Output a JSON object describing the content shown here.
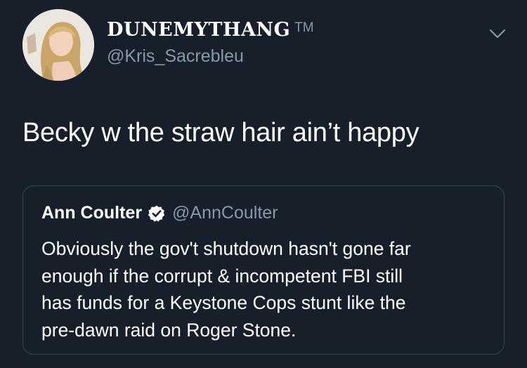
{
  "author": {
    "display_name": "DUNEMYTHANG",
    "trademark": "TM",
    "handle": "@Kris_Sacrebleu",
    "avatar_icon": "profile-photo"
  },
  "menu_icon": "chevron-down-icon",
  "tweet": {
    "text": "Becky w the straw hair ain’t happy"
  },
  "quoted_tweet": {
    "name": "Ann Coulter",
    "verified_icon": "verified-badge-icon",
    "handle": "@AnnCoulter",
    "lines": [
      "Obviously the gov't shutdown hasn't gone far",
      "enough if the corrupt & incompetent FBI still",
      "has funds for a Keystone Cops stunt like the",
      "pre-dawn raid on Roger Stone."
    ]
  },
  "colors": {
    "background": "#161f2a",
    "primary_text": "#ffffff",
    "secondary_text": "#8899a6",
    "quote_border": "#38444d"
  }
}
